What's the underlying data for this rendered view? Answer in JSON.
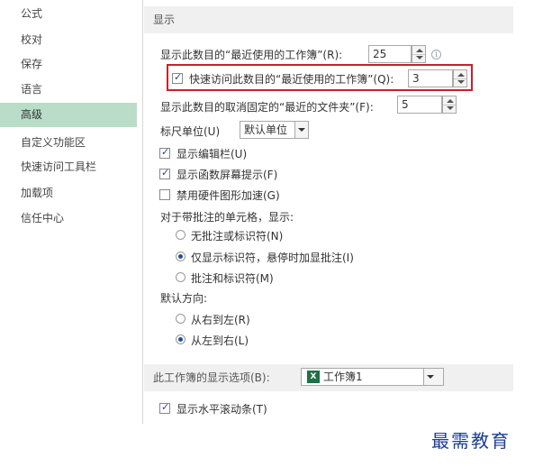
{
  "sidebar": {
    "items": [
      {
        "label": "公式"
      },
      {
        "label": "校对"
      },
      {
        "label": "保存"
      },
      {
        "label": "语言"
      },
      {
        "label": "高级"
      },
      {
        "label": "自定义功能区"
      },
      {
        "label": "快速访问工具栏"
      },
      {
        "label": "加载项"
      },
      {
        "label": "信任中心"
      }
    ]
  },
  "display": {
    "header": "显示",
    "recent_workbooks_label": "显示此数目的“最近使用的工作簿”(R):",
    "recent_workbooks_value": "25",
    "quick_access_label": "快速访问此数目的“最近使用的工作簿”(Q):",
    "quick_access_value": "3",
    "quick_access_checked": true,
    "recent_folders_label": "显示此数目的取消固定的“最近的文件夹”(F):",
    "recent_folders_value": "5",
    "ruler_units_label": "标尺单位(U)",
    "ruler_units_value": "默认单位",
    "show_formula_bar": "显示编辑栏(U)",
    "show_function_tips": "显示函数屏幕提示(F)",
    "disable_hw_accel": "禁用硬件图形加速(G)",
    "comments_label": "对于带批注的单元格，显示:",
    "comments_none": "无批注或标识符(N)",
    "comments_indicator_only": "仅显示标识符，悬停时加显批注(I)",
    "comments_both": "批注和标识符(M)",
    "direction_label": "默认方向:",
    "direction_rtl": "从右到左(R)",
    "direction_ltr": "从左到右(L)"
  },
  "workbook_display": {
    "header": "此工作簿的显示选项(B):",
    "workbook_name": "工作簿1",
    "show_h_scroll": "显示水平滚动条(T)"
  },
  "watermark": "最需教育",
  "colors": {
    "active_nav": "#b9ddc8",
    "highlight": "#c8202c",
    "watermark": "#1c3f93"
  }
}
